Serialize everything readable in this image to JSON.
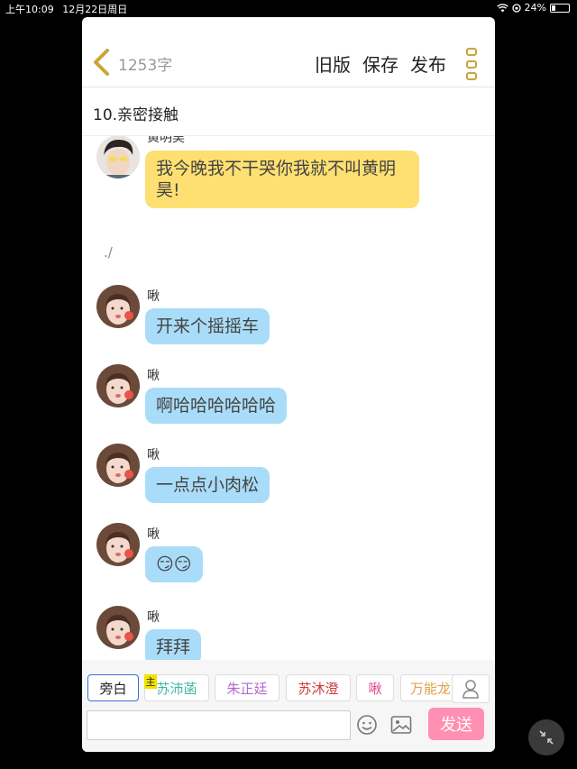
{
  "status_bar": {
    "time": "上午10:09",
    "date": "12月22日周日",
    "battery": "24%",
    "battery_level": 0.24
  },
  "header": {
    "char_count": "1253字",
    "old_version_label": "旧版",
    "save_label": "保存",
    "publish_label": "发布",
    "accent_color": "#c9a53a"
  },
  "chapter_title": "10.亲密接触",
  "messages": [
    {
      "speaker": "黄明昊",
      "text": "我今晚我不干哭你我就不叫黄明昊!",
      "color": "#fde071"
    },
    {
      "narration": "./"
    },
    {
      "speaker": "啾",
      "text": "开来个摇摇车",
      "color": "#a9dcf8"
    },
    {
      "speaker": "啾",
      "text": "啊哈哈哈哈哈哈",
      "color": "#a9dcf8"
    },
    {
      "speaker": "啾",
      "text": "一点点小肉松",
      "color": "#a9dcf8"
    },
    {
      "speaker": "啾",
      "text": "😏😏",
      "color": "#a9dcf8"
    },
    {
      "speaker": "啾",
      "text": "拜拜",
      "color": "#a9dcf8"
    }
  ],
  "composer": {
    "main_badge": "主",
    "characters": [
      {
        "name": "旁白",
        "color": "#222222"
      },
      {
        "name": "苏沛菡",
        "color": "#3fb8a8"
      },
      {
        "name": "朱正廷",
        "color": "#b06ad0"
      },
      {
        "name": "苏沐澄",
        "color": "#d03a3a"
      },
      {
        "name": "啾",
        "color": "#e04a8a"
      },
      {
        "name": "万能龙",
        "color": "#e6a04a"
      }
    ],
    "send_label": "发送",
    "send_color": "#ff8fb3"
  }
}
